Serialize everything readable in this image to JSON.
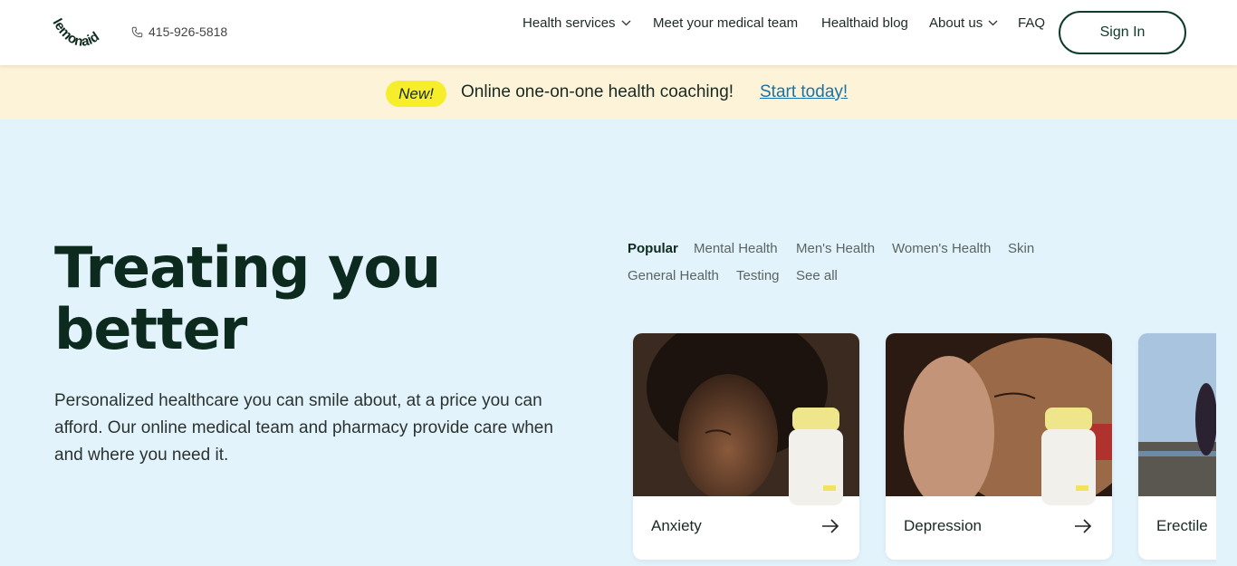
{
  "header": {
    "logo_text": "lemonaid",
    "phone": "415-926-5818",
    "nav": [
      {
        "label": "Health services",
        "has_dropdown": true
      },
      {
        "label": "Meet your medical team",
        "has_dropdown": false
      },
      {
        "label": "Healthaid blog",
        "has_dropdown": false
      },
      {
        "label": "About us",
        "has_dropdown": true
      },
      {
        "label": "FAQ",
        "has_dropdown": false
      }
    ],
    "signin_label": "Sign In"
  },
  "banner": {
    "badge": "New!",
    "text": "Online one-on-one health coaching!",
    "link": "Start today!"
  },
  "hero": {
    "title_line1": "Treating you",
    "title_line2": "better",
    "subtitle": "Personalized healthcare you can smile about, at a price you can afford. Our online medical team and pharmacy provide care when and where you need it."
  },
  "tabs": [
    {
      "label": "Popular",
      "active": true
    },
    {
      "label": "Mental Health",
      "active": false
    },
    {
      "label": "Men's Health",
      "active": false
    },
    {
      "label": "Women's Health",
      "active": false
    },
    {
      "label": "Skin",
      "active": false
    },
    {
      "label": "General Health",
      "active": false
    },
    {
      "label": "Testing",
      "active": false
    },
    {
      "label": "See all",
      "active": false
    }
  ],
  "cards": [
    {
      "label": "Anxiety",
      "icon": "arrow-right-icon"
    },
    {
      "label": "Depression",
      "icon": "arrow-right-icon"
    },
    {
      "label": "Erectile",
      "icon": "arrow-right-icon"
    }
  ],
  "colors": {
    "brand_dark": "#0f3b2e",
    "banner_bg": "#fdf3d8",
    "badge_bg": "#f6ee2a",
    "page_bg": "#e3f3fc",
    "link": "#1a73a8"
  }
}
